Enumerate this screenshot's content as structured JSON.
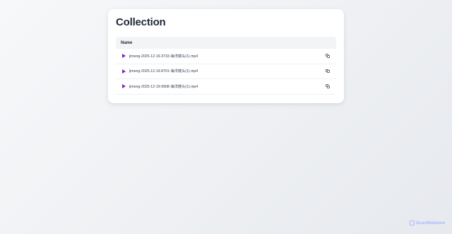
{
  "page": {
    "title": "Collection"
  },
  "table": {
    "header": "Name",
    "rows": [
      {
        "name": "jimeng-2025-12-19-3733-海洋镜头(1).mp4"
      },
      {
        "name": "jimeng-2025-12-19-8701-海洋镜头(1).mp4"
      },
      {
        "name": "jimeng-2025-12-19-9908-海洋镜头(1).mp4"
      }
    ]
  },
  "brand": {
    "label": "ScanMalware"
  },
  "icons": {
    "row_action": "copy-icon",
    "row_media": "play-icon",
    "brand": "scanmalware-logo-icon"
  },
  "colors": {
    "play_accent": "#7e22ce",
    "brand": "#a5b4fc"
  }
}
